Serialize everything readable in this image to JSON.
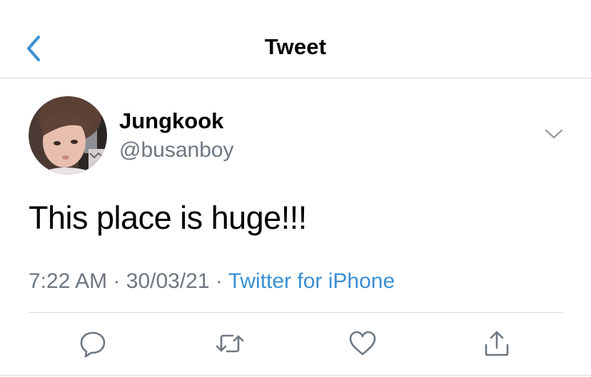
{
  "header": {
    "title": "Tweet",
    "back_icon": "chevron-left-icon",
    "accent_color": "#3b8fd4"
  },
  "tweet": {
    "author": {
      "display_name": "Jungkook",
      "handle": "@busanboy"
    },
    "text": "This place is huge!!!",
    "time": "7:22 AM",
    "date": "30/03/21",
    "separator": "·",
    "source": "Twitter for iPhone",
    "more_icon": "chevron-down-icon"
  },
  "actions": [
    {
      "name": "reply",
      "icon": "comment-icon"
    },
    {
      "name": "retweet",
      "icon": "retweet-icon"
    },
    {
      "name": "like",
      "icon": "heart-icon"
    },
    {
      "name": "share",
      "icon": "share-icon"
    }
  ],
  "colors": {
    "text": "#000000",
    "secondary": "#6e7780",
    "link": "#3b8fd4",
    "divider": "#d3d6da"
  }
}
